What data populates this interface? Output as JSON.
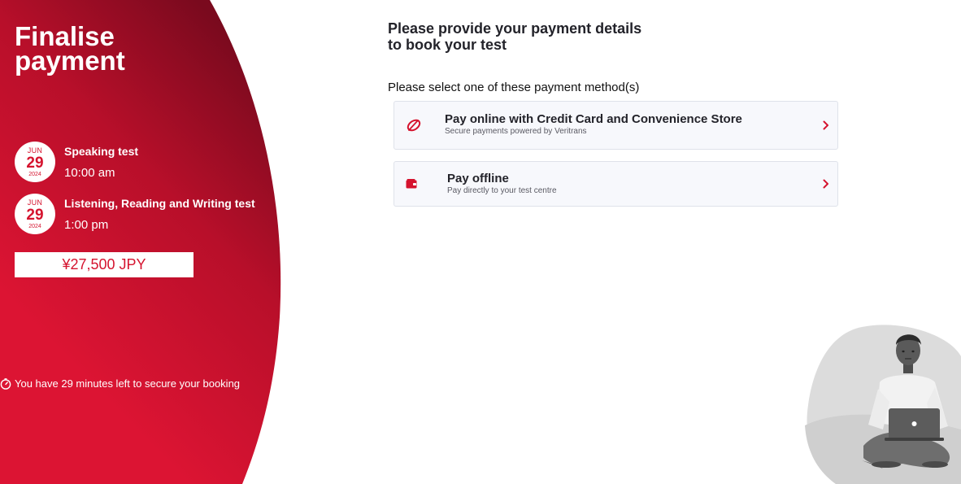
{
  "sidebar": {
    "title": "Finalise payment",
    "sessions": [
      {
        "month": "JUN",
        "day": "29",
        "year": "2024",
        "name": "Speaking test",
        "time": "10:00 am"
      },
      {
        "month": "JUN",
        "day": "29",
        "year": "2024",
        "name": "Listening, Reading and Writing test",
        "time": "1:00 pm"
      }
    ],
    "price": "¥27,500 JPY",
    "timer_text": "You have 29 minutes left to secure your booking",
    "timer_icon": "stopwatch-icon"
  },
  "main": {
    "heading": "Please provide your payment details to book your test",
    "prompt": "Please select one of these payment method(s)",
    "methods": [
      {
        "title": "Pay online with Credit Card and Convenience Store",
        "subtitle": "Secure payments powered by Veritrans",
        "icon": "veritrans-logo-icon"
      },
      {
        "title": "Pay offline",
        "subtitle": "Pay directly to your test centre",
        "icon": "wallet-icon"
      }
    ]
  },
  "colors": {
    "brand_red": "#d5132e",
    "brand_dark_red": "#7a0a1e",
    "card_bg": "#f7f8fc",
    "card_border": "#dfe2ea"
  }
}
